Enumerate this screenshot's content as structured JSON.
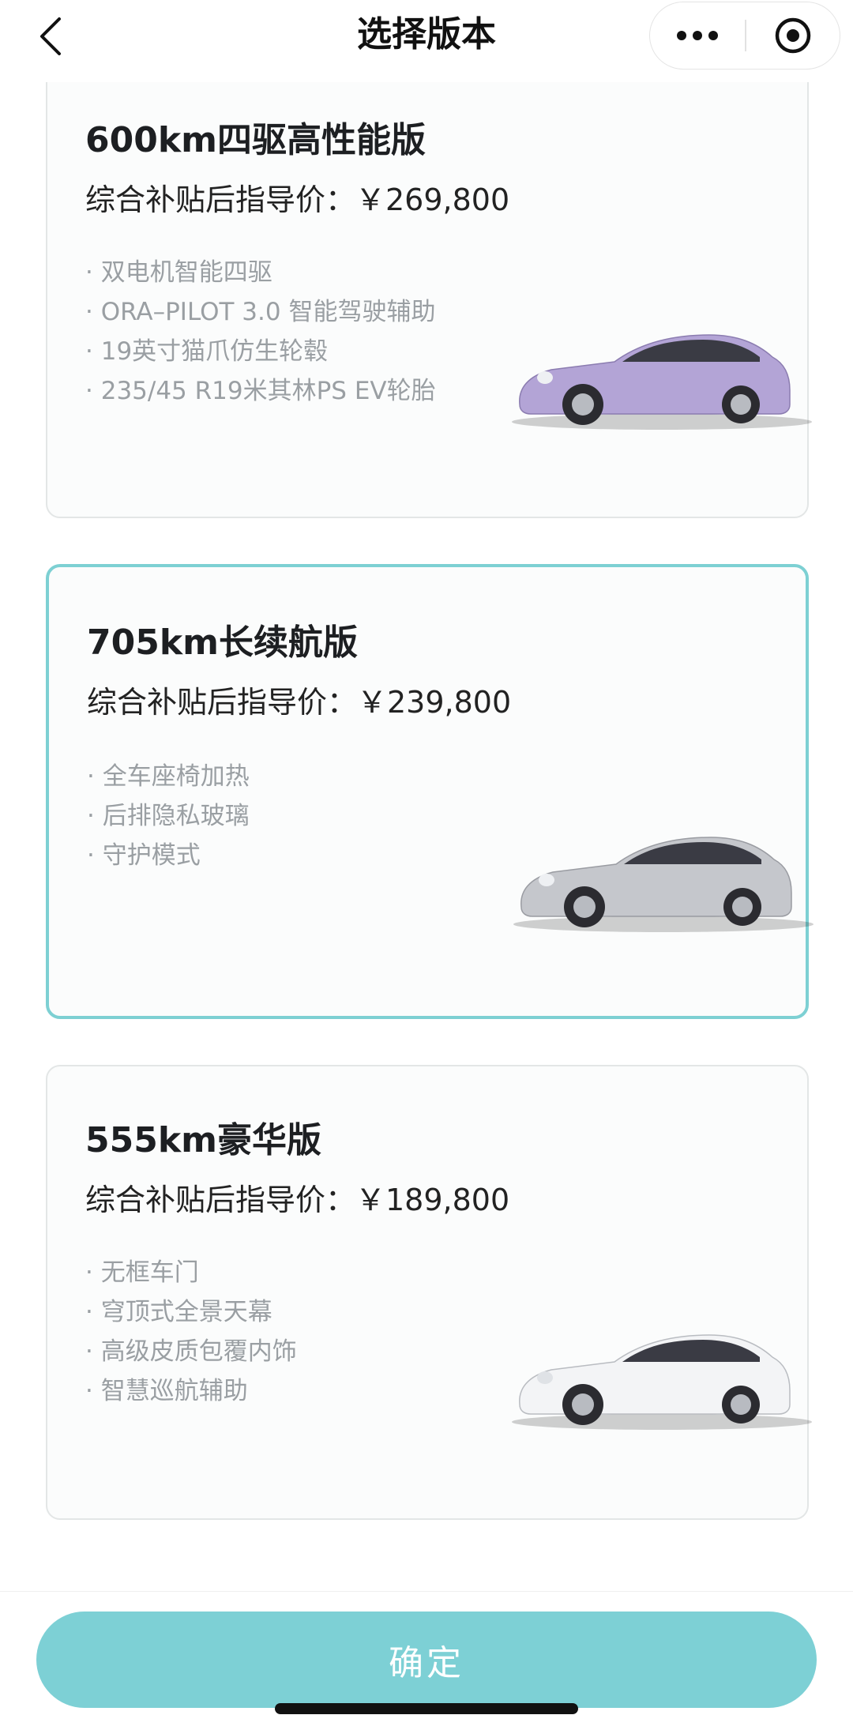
{
  "header": {
    "title": "选择版本",
    "back_icon": "chevron-left-icon",
    "more_icon": "more-dots-icon",
    "close_icon": "target-icon"
  },
  "versions": [
    {
      "name": "600km四驱高性能版",
      "price": "综合补贴后指导价：￥269,800",
      "features": [
        "双电机智能四驱",
        "ORA–PILOT 3.0 智能驾驶辅助",
        "19英寸猫爪仿生轮毂",
        "235/45 R19米其林PS EV轮胎"
      ],
      "car_color": "#b3a4d6",
      "selected": false
    },
    {
      "name": "705km长续航版",
      "price": "综合补贴后指导价：￥239,800",
      "features": [
        "全车座椅加热",
        "后排隐私玻璃",
        "守护模式"
      ],
      "car_color": "#c5c7cc",
      "selected": true
    },
    {
      "name": "555km豪华版",
      "price": "综合补贴后指导价：￥189,800",
      "features": [
        "无框车门",
        "穹顶式全景天幕",
        "高级皮质包覆内饰",
        "智慧巡航辅助"
      ],
      "car_color": "#f3f4f6",
      "selected": false
    }
  ],
  "confirm_label": "确定",
  "colors": {
    "accent": "#7dd0d5",
    "selected_border": "#7dd0d3"
  }
}
